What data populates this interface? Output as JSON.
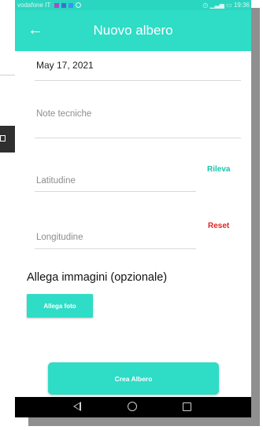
{
  "status_bar": {
    "carrier": "vodafone IT",
    "time": "19:36"
  },
  "app_bar": {
    "title": "Nuovo albero"
  },
  "form": {
    "date_value": "May 17, 2021",
    "note_placeholder": "Note tecniche",
    "latitude_placeholder": "Latitudine",
    "longitude_placeholder": "Longitudine",
    "rileva_label": "Rileva",
    "reset_label": "Reset"
  },
  "attachments": {
    "title": "Allega immagini (opzionale)",
    "button_label": "Allega foto"
  },
  "submit": {
    "label": "Crea Albero"
  },
  "colors": {
    "accent": "#2fdcc6",
    "reset": "#e52222"
  }
}
